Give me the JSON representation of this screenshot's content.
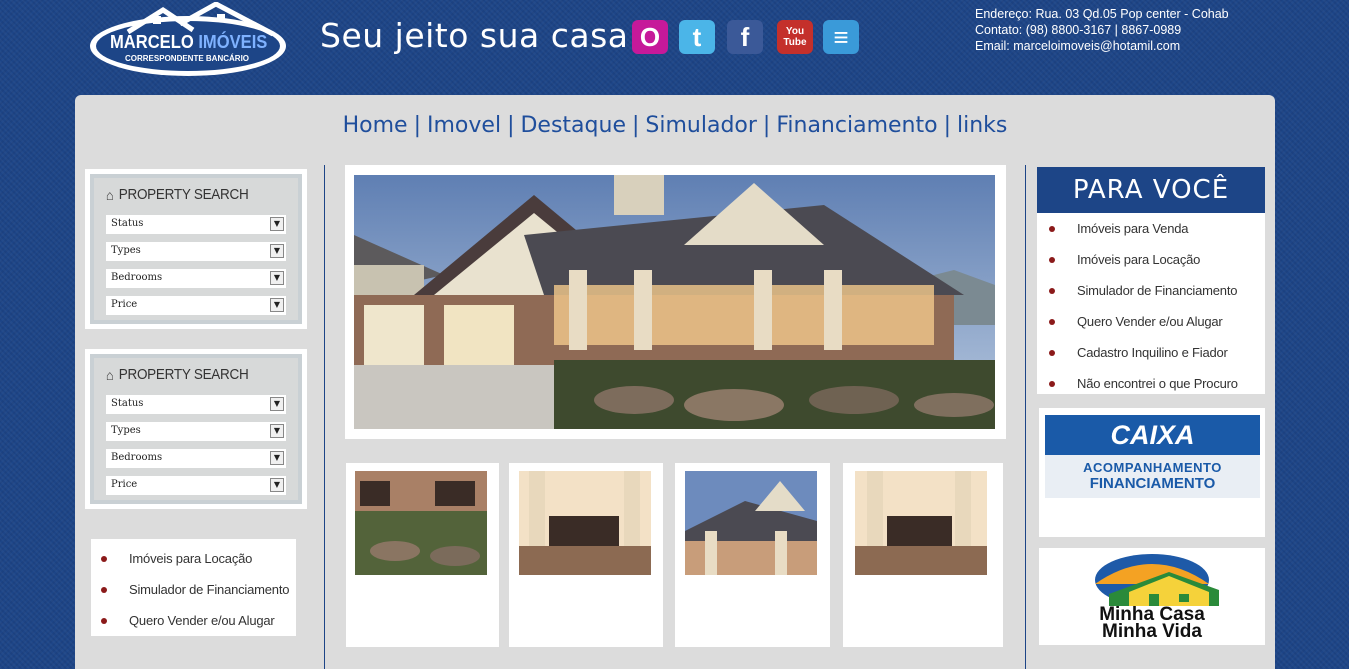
{
  "header": {
    "logo_name": "MARCELO",
    "logo_name2": "IMÓVEIS",
    "logo_sub": "CORRESPONDENTE BANCÁRIO",
    "tagline": "Seu jeito sua casa.",
    "social": [
      {
        "name": "orkut-icon",
        "glyph": "O",
        "color": "#c6199a"
      },
      {
        "name": "twitter-icon",
        "glyph": "t",
        "color": "#4bb5e8"
      },
      {
        "name": "facebook-icon",
        "glyph": "f",
        "color": "#3b5998"
      },
      {
        "name": "youtube-icon",
        "glyph": "You Tube",
        "color": "#c4302b"
      },
      {
        "name": "chat-icon",
        "glyph": "≡",
        "color": "#3a9ad9"
      }
    ],
    "contact": {
      "address": "Endereço: Rua. 03 Qd.05 Pop center - Cohab",
      "phone": "Contato: (98) 8800-3167 | 8867-0989",
      "email": "Email: marceloimoveis@hotamil.com"
    }
  },
  "nav": {
    "items": [
      "Home",
      "Imovel",
      "Destaque",
      "Simulador",
      "Financiamento",
      "links"
    ],
    "separator": "|"
  },
  "search_boxes": [
    {
      "title": "PROPERTY SEARCH",
      "fields": [
        "Status",
        "Types",
        "Bedrooms",
        "Price"
      ]
    },
    {
      "title": "PROPERTY SEARCH",
      "fields": [
        "Status",
        "Types",
        "Bedrooms",
        "Price"
      ]
    }
  ],
  "left_links": [
    "Imóveis para Locação",
    "Simulador de Financiamento",
    "Quero Vender e/ou Alugar"
  ],
  "para_voce": {
    "title": "PARA VOCÊ",
    "links": [
      "Imóveis para Venda",
      "Imóveis para Locação",
      "Simulador de Financiamento",
      "Quero Vender e/ou Alugar",
      "Cadastro Inquilino e Fiador",
      "Não encontrei o que Procuro"
    ]
  },
  "ads": {
    "caixa": {
      "brand": "CAIXA",
      "line1": "ACOMPANHAMENTO",
      "line2": "FINANCIAMENTO"
    },
    "mcmv": {
      "line1": "Minha Casa",
      "line2": "Minha Vida"
    }
  },
  "colors": {
    "brand_blue": "#1d4587",
    "nav_blue": "#1f4e9c",
    "bullet": "#8b1a1a"
  }
}
